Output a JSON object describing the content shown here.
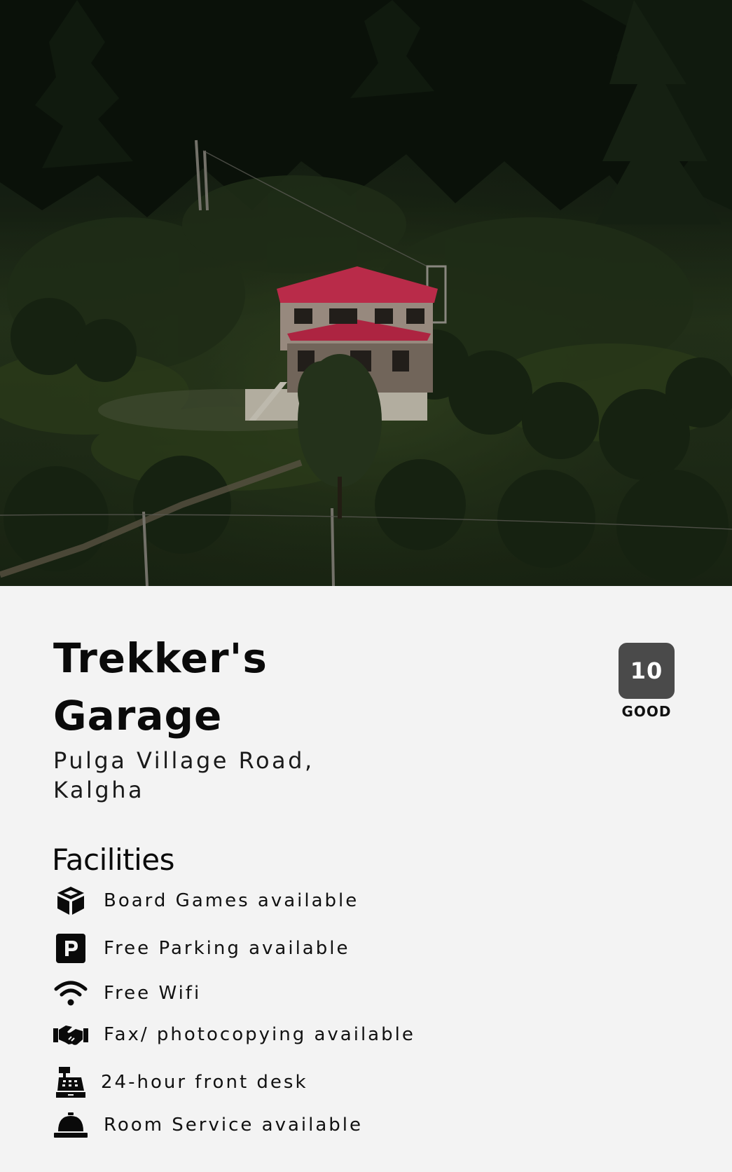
{
  "hotel": {
    "name": "Trekker's Garage",
    "address": "Pulga Village Road, Kalgha",
    "rating": {
      "score": "10",
      "label": "GOOD",
      "badge_color": "#4a4a4a"
    }
  },
  "facilities": {
    "heading": "Facilities",
    "items": [
      {
        "icon": "cube-icon",
        "label": "Board Games available"
      },
      {
        "icon": "parking-icon",
        "label": "Free Parking available"
      },
      {
        "icon": "wifi-icon",
        "label": "Free Wifi"
      },
      {
        "icon": "handshake-icon",
        "label": "Fax/ photocopying available"
      },
      {
        "icon": "cash-register-icon",
        "label": "24-hour front desk"
      },
      {
        "icon": "service-bell-icon",
        "label": "Room Service available"
      }
    ]
  },
  "colors": {
    "page_background": "#f3f3f3",
    "roof": "#e2355a",
    "text": "#0a0a0a"
  }
}
